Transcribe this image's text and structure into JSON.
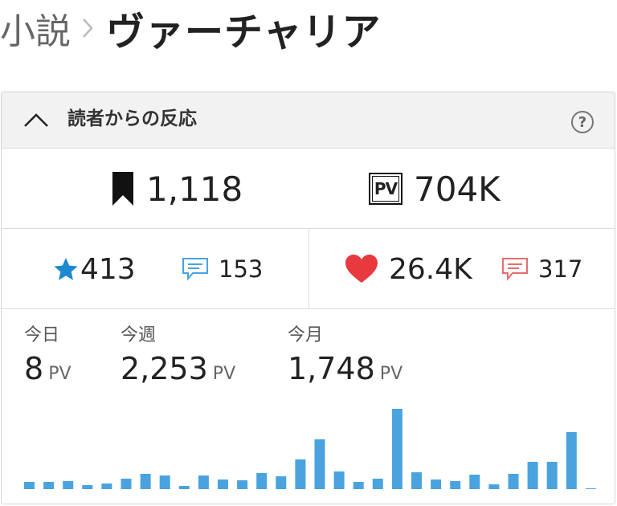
{
  "breadcrumb": {
    "parent": "小説",
    "title": "ヴァーチャリア"
  },
  "panel": {
    "title": "読者からの反応",
    "help_symbol": "?"
  },
  "stats": {
    "bookmarks": "1,118",
    "pv_total": "704K",
    "pv_badge": "PV",
    "stars": "413",
    "comments": "153",
    "hearts": "26.4K",
    "reviews": "317"
  },
  "pv_periods": [
    {
      "label": "今日",
      "value": "8",
      "unit": "PV"
    },
    {
      "label": "今週",
      "value": "2,253",
      "unit": "PV"
    },
    {
      "label": "今月",
      "value": "1,748",
      "unit": "PV"
    }
  ],
  "colors": {
    "accent_blue": "#4aa3df",
    "star_blue": "#1e88d0",
    "heart_red": "#e8393f",
    "review_red": "#e86d6d"
  },
  "chart_data": {
    "type": "bar",
    "values": [
      9,
      9,
      10,
      5,
      7,
      13,
      19,
      17,
      4,
      17,
      12,
      11,
      20,
      16,
      37,
      62,
      22,
      9,
      13,
      100,
      21,
      12,
      10,
      18,
      6,
      19,
      34,
      34,
      71,
      1
    ],
    "color": "#4aa3df"
  }
}
